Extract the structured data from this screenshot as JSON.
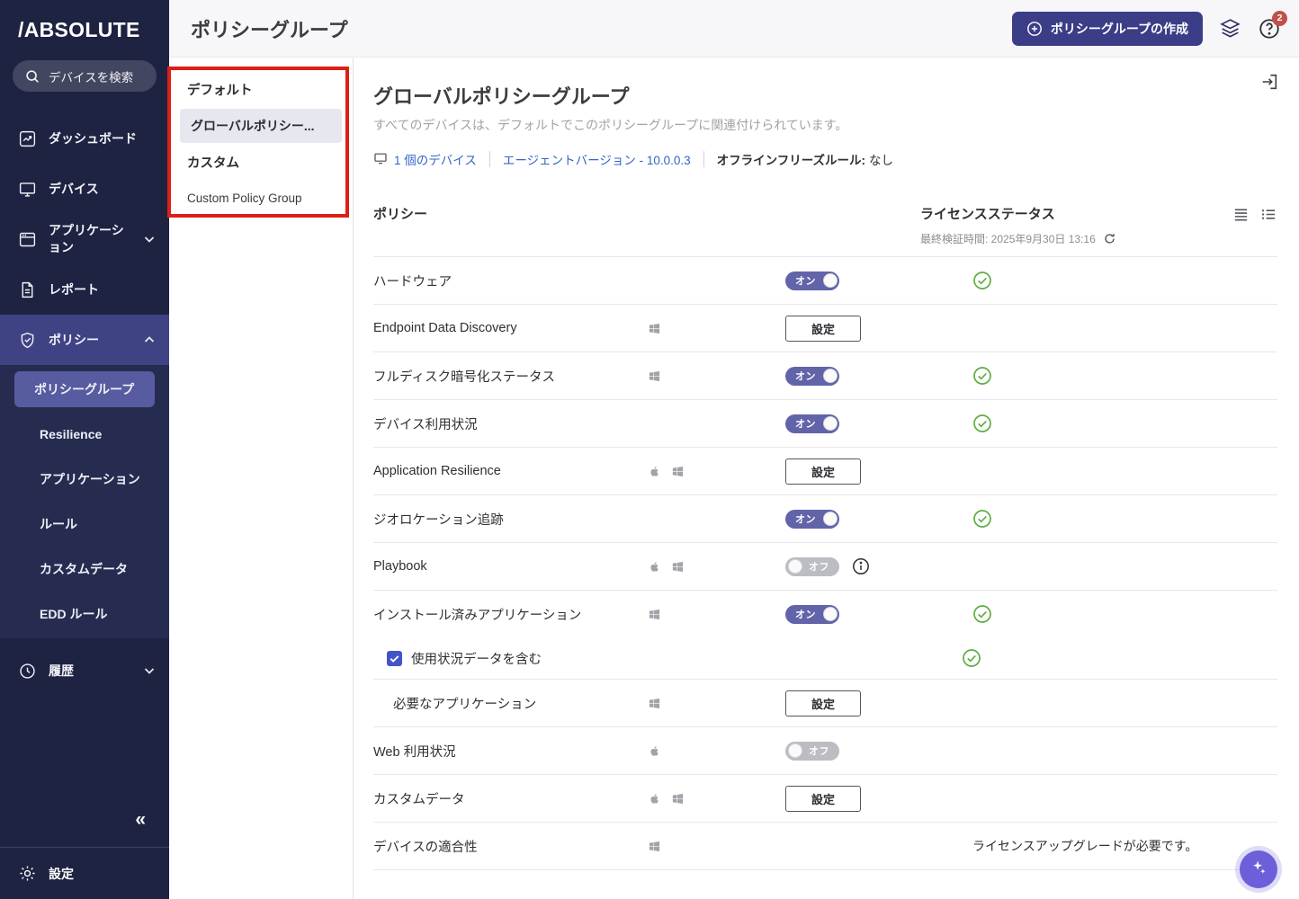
{
  "colors": {
    "sidebar_bg": "#1e2342",
    "accent_purple": "#575b9f",
    "toggle_on": "#6164a9",
    "toggle_off": "#bcbcc3",
    "status_green": "#5fad45",
    "link_blue": "#3465c8",
    "annotation_red": "#dd1f17",
    "create_button": "#3b3d87"
  },
  "sidebar": {
    "logo": "/ABSOLUTE",
    "search_placeholder": "デバイスを検索",
    "items": [
      {
        "label": "ダッシュボード",
        "icon": "dashboard-icon"
      },
      {
        "label": "デバイス",
        "icon": "devices-icon"
      },
      {
        "label": "アプリケーション",
        "icon": "applications-icon",
        "chevron": "down"
      },
      {
        "label": "レポート",
        "icon": "reports-icon"
      },
      {
        "label": "ポリシー",
        "icon": "policy-icon",
        "chevron": "up",
        "active": true
      },
      {
        "label": "履歴",
        "icon": "history-icon",
        "chevron": "down"
      }
    ],
    "policy_subitems": [
      {
        "label": "ポリシーグループ",
        "selected": true
      },
      {
        "label": "Resilience"
      },
      {
        "label": "アプリケーション"
      },
      {
        "label": "ルール"
      },
      {
        "label": "カスタムデータ"
      },
      {
        "label": "EDD ルール"
      }
    ],
    "collapse_label": "«",
    "settings_label": "設定"
  },
  "header": {
    "page_title": "ポリシーグループ",
    "create_button_label": "ポリシーグループの作成",
    "icons": [
      "plus-icon",
      "layers-icon",
      "help-icon"
    ],
    "notifications_badge": "2"
  },
  "group_list": {
    "section_default": "デフォルト",
    "selected_group": "グローバルポリシー...",
    "section_custom": "カスタム",
    "custom_group": "Custom Policy Group"
  },
  "content": {
    "group_title": "グローバルポリシーグループ",
    "group_subtitle": "すべてのデバイスは、デフォルトでこのポリシーグループに関連付けられています。",
    "devices_link": "1 個のデバイス",
    "agent_version_link": "エージェントバージョン - 10.0.0.3",
    "offline_rule_label": "オフラインフリーズルール:",
    "offline_rule_value": "なし",
    "policy_column": "ポリシー",
    "license_column": "ライセンスステータス",
    "last_verified": "最終検証時間: 2025年9月30日 13:16",
    "rows": [
      {
        "label": "ハードウェア",
        "platforms": [],
        "control": "toggle-on",
        "control_label": "オン",
        "status": "check"
      },
      {
        "label": "Endpoint Data Discovery",
        "platforms": [
          "windows"
        ],
        "control": "button",
        "control_label": "設定",
        "status": "none"
      },
      {
        "label": "フルディスク暗号化ステータス",
        "platforms": [
          "windows"
        ],
        "control": "toggle-on",
        "control_label": "オン",
        "status": "check"
      },
      {
        "label": "デバイス利用状況",
        "platforms": [],
        "control": "toggle-on",
        "control_label": "オン",
        "status": "check"
      },
      {
        "label": "Application Resilience",
        "platforms": [
          "apple",
          "windows"
        ],
        "control": "button",
        "control_label": "設定",
        "status": "none"
      },
      {
        "label": "ジオロケーション追跡",
        "platforms": [],
        "control": "toggle-on",
        "control_label": "オン",
        "status": "check"
      },
      {
        "label": "Playbook",
        "platforms": [
          "apple",
          "windows"
        ],
        "control": "toggle-off",
        "control_label": "オフ",
        "info": true,
        "status": "none"
      },
      {
        "label": "インストール済みアプリケーション",
        "platforms": [
          "windows"
        ],
        "control": "toggle-on",
        "control_label": "オン",
        "status": "check"
      },
      {
        "label": "使用状況データを含む",
        "type": "checkbox",
        "checked": true,
        "control": "none",
        "status": "check",
        "status_shift": true,
        "no_top_divider": true
      },
      {
        "label": "必要なアプリケーション",
        "platforms": [
          "windows"
        ],
        "control": "button",
        "control_label": "設定",
        "status": "none",
        "indent": true
      },
      {
        "label": "Web 利用状況",
        "platforms": [
          "apple"
        ],
        "control": "toggle-off",
        "control_label": "オフ",
        "status": "none"
      },
      {
        "label": "カスタムデータ",
        "platforms": [
          "apple",
          "windows"
        ],
        "control": "button",
        "control_label": "設定",
        "status": "none"
      },
      {
        "label": "デバイスの適合性",
        "platforms": [
          "windows"
        ],
        "control": "none",
        "status": "text",
        "status_text": "ライセンスアップグレードが必要です。"
      }
    ]
  }
}
